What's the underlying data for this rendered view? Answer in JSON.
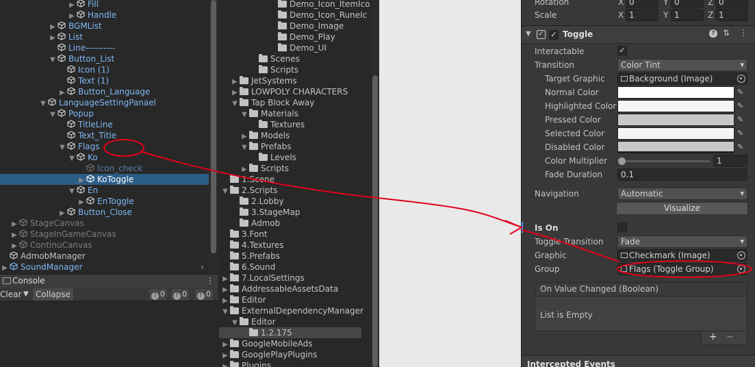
{
  "hierarchy": {
    "items": [
      {
        "label": "Fill",
        "depth": 10,
        "type": "obj",
        "arrow": "▶"
      },
      {
        "label": "Handle",
        "depth": 10,
        "type": "obj",
        "arrow": "▶"
      },
      {
        "label": "BGMList",
        "depth": 8,
        "type": "obj",
        "arrow": "▶"
      },
      {
        "label": "List",
        "depth": 8,
        "type": "obj",
        "arrow": "▶"
      },
      {
        "label": "Line----------",
        "depth": 8,
        "type": "obj",
        "arrow": ""
      },
      {
        "label": "Button_List",
        "depth": 8,
        "type": "obj",
        "arrow": "▼"
      },
      {
        "label": "Icon (1)",
        "depth": 9,
        "type": "obj",
        "arrow": ""
      },
      {
        "label": "Text (1)",
        "depth": 9,
        "type": "obj",
        "arrow": ""
      },
      {
        "label": "Button_Language",
        "depth": 9,
        "type": "obj",
        "arrow": "▶"
      },
      {
        "label": "LanguageSettingPanael",
        "depth": 7,
        "type": "obj",
        "arrow": "▼"
      },
      {
        "label": "Popup",
        "depth": 8,
        "type": "obj",
        "arrow": "▼"
      },
      {
        "label": "TitleLine",
        "depth": 9,
        "type": "obj",
        "arrow": ""
      },
      {
        "label": "Text_Title",
        "depth": 9,
        "type": "obj",
        "arrow": ""
      },
      {
        "label": "Flags",
        "depth": 9,
        "type": "obj",
        "arrow": "▼"
      },
      {
        "label": "Ko",
        "depth": 10,
        "type": "obj",
        "arrow": "▼"
      },
      {
        "label": "Icon_check",
        "depth": 11,
        "type": "disabled",
        "arrow": ""
      },
      {
        "label": "KoToggle",
        "depth": 11,
        "type": "selected",
        "arrow": "▶"
      },
      {
        "label": "En",
        "depth": 10,
        "type": "obj",
        "arrow": "▼"
      },
      {
        "label": "EnToggle",
        "depth": 11,
        "type": "obj",
        "arrow": "▶"
      },
      {
        "label": "Button_Close",
        "depth": 9,
        "type": "obj",
        "arrow": "▶"
      },
      {
        "label": "StageCanvas",
        "depth": 4,
        "type": "inactive",
        "arrow": "▶"
      },
      {
        "label": "StageInGameCanvas",
        "depth": 4,
        "type": "inactive",
        "arrow": "▶"
      },
      {
        "label": "ContinuCanvas",
        "depth": 4,
        "type": "inactive",
        "arrow": "▶"
      },
      {
        "label": "AdmobManager",
        "depth": 3,
        "type": "plain",
        "arrow": ""
      },
      {
        "label": "SoundManager",
        "depth": 3,
        "type": "prefab",
        "arrow": "▶"
      }
    ]
  },
  "console": {
    "tab": "Console",
    "clear": "Clear",
    "collapse": "Collapse",
    "counts": [
      "0",
      "0",
      "0"
    ]
  },
  "project": {
    "items": [
      {
        "label": "Demo_Icon_ItemIco",
        "depth": 6,
        "arrow": ""
      },
      {
        "label": "Demo_Icon_RuneIc",
        "depth": 6,
        "arrow": ""
      },
      {
        "label": "Demo_Image",
        "depth": 6,
        "arrow": ""
      },
      {
        "label": "Demo_Play",
        "depth": 6,
        "arrow": ""
      },
      {
        "label": "Demo_UI",
        "depth": 6,
        "arrow": ""
      },
      {
        "label": "Scenes",
        "depth": 4,
        "arrow": ""
      },
      {
        "label": "Scripts",
        "depth": 4,
        "arrow": ""
      },
      {
        "label": "JetSystems",
        "depth": 2,
        "arrow": "▶"
      },
      {
        "label": "LOWPOLY CHARACTERS",
        "depth": 2,
        "arrow": "▶"
      },
      {
        "label": "Tap Block Away",
        "depth": 2,
        "arrow": "▼"
      },
      {
        "label": "Materials",
        "depth": 3,
        "arrow": "▼"
      },
      {
        "label": "Textures",
        "depth": 4,
        "arrow": ""
      },
      {
        "label": "Models",
        "depth": 3,
        "arrow": "▶"
      },
      {
        "label": "Prefabs",
        "depth": 3,
        "arrow": "▼"
      },
      {
        "label": "Levels",
        "depth": 4,
        "arrow": ""
      },
      {
        "label": "Scripts",
        "depth": 3,
        "arrow": "▶"
      },
      {
        "label": "1.Scene",
        "depth": 1,
        "arrow": ""
      },
      {
        "label": "2.Scripts",
        "depth": 1,
        "arrow": "▼"
      },
      {
        "label": "2.Lobby",
        "depth": 2,
        "arrow": ""
      },
      {
        "label": "3.StageMap",
        "depth": 2,
        "arrow": ""
      },
      {
        "label": "Admob",
        "depth": 2,
        "arrow": ""
      },
      {
        "label": "3.Font",
        "depth": 1,
        "arrow": ""
      },
      {
        "label": "4.Textures",
        "depth": 1,
        "arrow": ""
      },
      {
        "label": "5.Prefabs",
        "depth": 1,
        "arrow": ""
      },
      {
        "label": "6.Sound",
        "depth": 1,
        "arrow": ""
      },
      {
        "label": "7.LocalSettings",
        "depth": 1,
        "arrow": "▶"
      },
      {
        "label": "AddressableAssetsData",
        "depth": 1,
        "arrow": "▶"
      },
      {
        "label": "Editor",
        "depth": 1,
        "arrow": "▶"
      },
      {
        "label": "ExternalDependencyManager",
        "depth": 1,
        "arrow": "▼"
      },
      {
        "label": "Editor",
        "depth": 2,
        "arrow": "▼"
      },
      {
        "label": "1.2.175",
        "depth": 3,
        "arrow": "",
        "selected": true
      },
      {
        "label": "GoogleMobileAds",
        "depth": 1,
        "arrow": "▶"
      },
      {
        "label": "GooglePlayPlugins",
        "depth": 1,
        "arrow": "▶"
      },
      {
        "label": "Plugins",
        "depth": 1,
        "arrow": "▶"
      }
    ]
  },
  "inspector": {
    "transform": {
      "rotation_label": "Rotation",
      "scale_label": "Scale",
      "rotation": {
        "x": "0",
        "y": "0",
        "z": "0"
      },
      "scale": {
        "x": "1",
        "y": "1",
        "z": "1"
      }
    },
    "component_title": "Toggle",
    "header_icons": [
      "help-icon",
      "preset-icon",
      "menu-icon"
    ],
    "labels": {
      "interactable": "Interactable",
      "transition": "Transition",
      "target_graphic": "Target Graphic",
      "normal_color": "Normal Color",
      "highlighted_color": "Highlighted Color",
      "pressed_color": "Pressed Color",
      "selected_color": "Selected Color",
      "disabled_color": "Disabled Color",
      "color_multiplier": "Color Multiplier",
      "fade_duration": "Fade Duration",
      "navigation": "Navigation",
      "is_on": "Is On",
      "toggle_transition": "Toggle Transition",
      "graphic": "Graphic",
      "group": "Group"
    },
    "values": {
      "transition": "Color Tint",
      "target_graphic": "Background (Image)",
      "color_multiplier": "1",
      "color_multiplier_fraction": 0,
      "fade_duration": "0.1",
      "navigation": "Automatic",
      "visualize": "Visualize",
      "toggle_transition": "Fade",
      "graphic": "Checkmark (Image)",
      "group": "Flags (Toggle Group)"
    },
    "colors": {
      "normal": "#ffffff",
      "highlighted": "#f5f5f5",
      "pressed": "#c8c8c8",
      "selected": "#f5f5f5",
      "disabled": "#c8c8c8"
    },
    "event": {
      "title": "On Value Changed (Boolean)",
      "empty": "List is Empty",
      "add": "+",
      "remove": "−"
    },
    "next_section": "Intercepted Events"
  },
  "annotation_color": "#e3001b"
}
